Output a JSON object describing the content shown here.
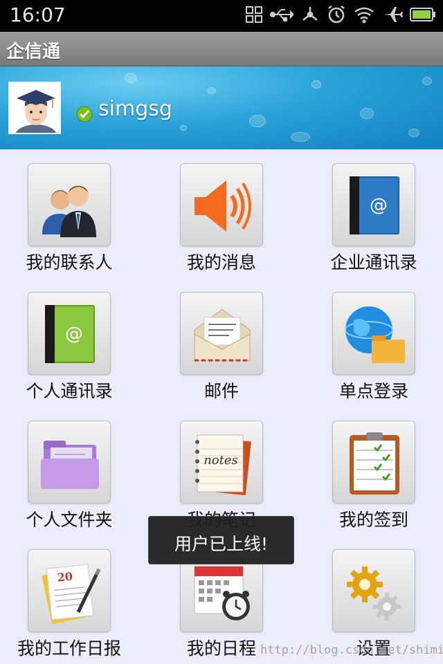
{
  "status_bar": {
    "time": "16:07"
  },
  "app": {
    "title": "企信通"
  },
  "profile": {
    "username": "simgsg",
    "online": true
  },
  "menu": [
    {
      "label": "我的联系人",
      "icon": "contacts-icon"
    },
    {
      "label": "我的消息",
      "icon": "speaker-icon"
    },
    {
      "label": "企业通讯录",
      "icon": "blue-address-book-icon"
    },
    {
      "label": "个人通讯录",
      "icon": "green-address-book-icon"
    },
    {
      "label": "邮件",
      "icon": "envelope-icon"
    },
    {
      "label": "单点登录",
      "icon": "globe-folder-icon"
    },
    {
      "label": "个人文件夹",
      "icon": "purple-folder-icon"
    },
    {
      "label": "我的笔记",
      "icon": "notes-icon"
    },
    {
      "label": "我的签到",
      "icon": "clipboard-checklist-icon"
    },
    {
      "label": "我的工作日报",
      "icon": "daily-report-icon"
    },
    {
      "label": "我的日程",
      "icon": "calendar-clock-icon"
    },
    {
      "label": "设置",
      "icon": "gears-icon"
    }
  ],
  "toast": {
    "message": "用户已上线!"
  },
  "watermark": "http://blog.csdn.net/shimiso",
  "colors": {
    "banner": "#2aa2d8",
    "background": "#ececfa",
    "toast": "#202020",
    "online": "#7bbf1a"
  }
}
